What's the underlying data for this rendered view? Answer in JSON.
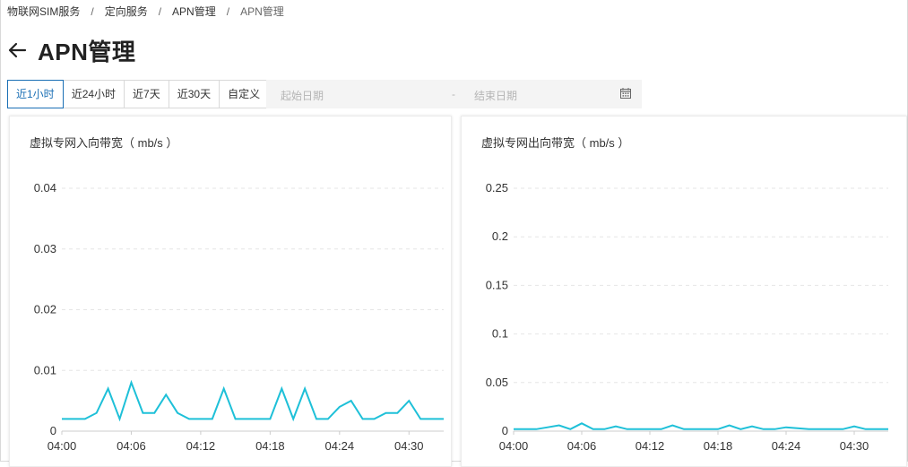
{
  "breadcrumb": {
    "items": [
      "物联网SIM服务",
      "定向服务",
      "APN管理"
    ],
    "current": "APN管理",
    "separator": "/"
  },
  "page": {
    "title": "APN管理"
  },
  "time_range": {
    "buttons": [
      "近1小时",
      "近24小时",
      "近7天",
      "近30天",
      "自定义"
    ],
    "active_index": 0,
    "start_placeholder": "起始日期",
    "separator": "-",
    "end_placeholder": "结束日期"
  },
  "colors": {
    "series": "#1ec0d8",
    "active": "#1a6fb5",
    "grid": "#e6e6e6"
  },
  "chart_data": [
    {
      "type": "line",
      "title": "虚拟专网入向带宽（ mb/s ）",
      "x_labels": [
        "04:00",
        "04:06",
        "04:12",
        "04:18",
        "04:24",
        "04:30"
      ],
      "y_ticks": [
        "0",
        "0.01",
        "0.02",
        "0.03",
        "0.04"
      ],
      "ylim": [
        0,
        0.04
      ],
      "grid": true,
      "x": [
        "04:00",
        "04:01",
        "04:02",
        "04:03",
        "04:04",
        "04:05",
        "04:06",
        "04:07",
        "04:08",
        "04:09",
        "04:10",
        "04:11",
        "04:12",
        "04:13",
        "04:14",
        "04:15",
        "04:16",
        "04:17",
        "04:18",
        "04:19",
        "04:20",
        "04:21",
        "04:22",
        "04:23",
        "04:24",
        "04:25",
        "04:26",
        "04:27",
        "04:28",
        "04:29",
        "04:30",
        "04:31",
        "04:32",
        "04:33"
      ],
      "values": [
        0.002,
        0.002,
        0.002,
        0.003,
        0.007,
        0.002,
        0.008,
        0.003,
        0.003,
        0.006,
        0.003,
        0.002,
        0.002,
        0.002,
        0.007,
        0.002,
        0.002,
        0.002,
        0.002,
        0.007,
        0.002,
        0.007,
        0.002,
        0.002,
        0.004,
        0.005,
        0.002,
        0.002,
        0.003,
        0.003,
        0.005,
        0.002,
        0.002,
        0.002
      ]
    },
    {
      "type": "line",
      "title": "虚拟专网出向带宽（ mb/s ）",
      "x_labels": [
        "04:00",
        "04:06",
        "04:12",
        "04:18",
        "04:24",
        "04:30"
      ],
      "y_ticks": [
        "0",
        "0.05",
        "0.1",
        "0.15",
        "0.2",
        "0.25"
      ],
      "ylim": [
        0,
        0.25
      ],
      "grid": true,
      "x": [
        "04:00",
        "04:01",
        "04:02",
        "04:03",
        "04:04",
        "04:05",
        "04:06",
        "04:07",
        "04:08",
        "04:09",
        "04:10",
        "04:11",
        "04:12",
        "04:13",
        "04:14",
        "04:15",
        "04:16",
        "04:17",
        "04:18",
        "04:19",
        "04:20",
        "04:21",
        "04:22",
        "04:23",
        "04:24",
        "04:25",
        "04:26",
        "04:27",
        "04:28",
        "04:29",
        "04:30",
        "04:31",
        "04:32",
        "04:33"
      ],
      "values": [
        0.002,
        0.002,
        0.002,
        0.004,
        0.006,
        0.002,
        0.008,
        0.002,
        0.002,
        0.005,
        0.002,
        0.002,
        0.002,
        0.002,
        0.006,
        0.002,
        0.002,
        0.002,
        0.002,
        0.006,
        0.002,
        0.005,
        0.002,
        0.002,
        0.004,
        0.003,
        0.002,
        0.002,
        0.002,
        0.002,
        0.005,
        0.002,
        0.002,
        0.002
      ]
    }
  ]
}
